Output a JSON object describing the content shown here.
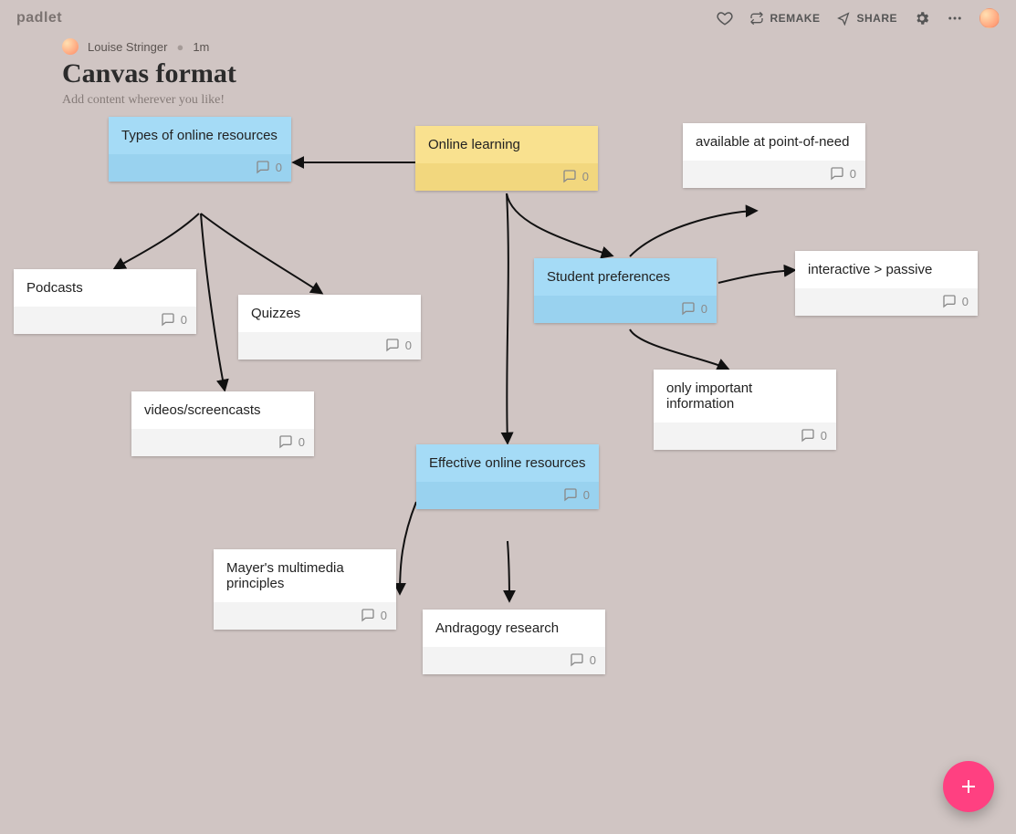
{
  "brand": "padlet",
  "topbar": {
    "remake": "REMAKE",
    "share": "SHARE"
  },
  "header": {
    "author": "Louise Stringer",
    "time": "1m",
    "title": "Canvas format",
    "subtitle": "Add content wherever you like!"
  },
  "cards": {
    "types": {
      "title": "Types of online resources",
      "comments": "0"
    },
    "online": {
      "title": "Online learning",
      "comments": "0"
    },
    "pointneed": {
      "title": "available at point-of-need",
      "comments": "0"
    },
    "podcasts": {
      "title": "Podcasts",
      "comments": "0"
    },
    "quizzes": {
      "title": "Quizzes",
      "comments": "0"
    },
    "studpref": {
      "title": "Student preferences",
      "comments": "0"
    },
    "interactive": {
      "title": "interactive > passive",
      "comments": "0"
    },
    "videos": {
      "title": "videos/screencasts",
      "comments": "0"
    },
    "onlyimp": {
      "title": "only important information",
      "comments": "0"
    },
    "effective": {
      "title": "Effective online resources",
      "comments": "0"
    },
    "mayer": {
      "title": "Mayer's multimedia principles",
      "comments": "0"
    },
    "andragogy": {
      "title": "Andragogy research",
      "comments": "0"
    }
  }
}
